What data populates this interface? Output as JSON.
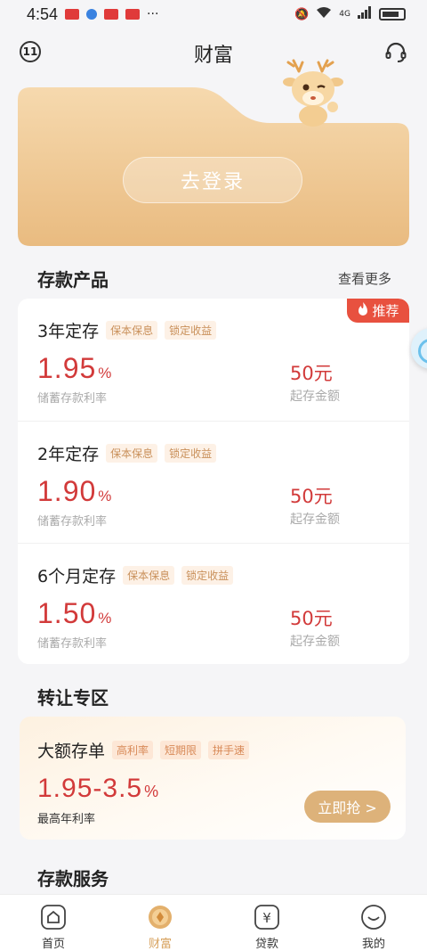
{
  "status_bar": {
    "time": "4:54",
    "network": "4G"
  },
  "header": {
    "title": "财富",
    "left_icon": "wealth-mark-icon",
    "right_icon": "headset-icon"
  },
  "hero": {
    "login_label": "去登录",
    "mascot_icon": "deer-mascot-icon"
  },
  "deposit_section": {
    "title": "存款产品",
    "more_label": "查看更多",
    "badge_label": "推荐",
    "products": [
      {
        "name": "3年定存",
        "tags": [
          "保本保息",
          "锁定收益"
        ],
        "rate": "1.95",
        "rate_unit": "%",
        "rate_label": "储蓄存款利率",
        "amount": "50元",
        "amount_label": "起存金额"
      },
      {
        "name": "2年定存",
        "tags": [
          "保本保息",
          "锁定收益"
        ],
        "rate": "1.90",
        "rate_unit": "%",
        "rate_label": "储蓄存款利率",
        "amount": "50元",
        "amount_label": "起存金额"
      },
      {
        "name": "6个月定存",
        "tags": [
          "保本保息",
          "锁定收益"
        ],
        "rate": "1.50",
        "rate_unit": "%",
        "rate_label": "储蓄存款利率",
        "amount": "50元",
        "amount_label": "起存金额"
      }
    ]
  },
  "transfer_section": {
    "title": "转让专区",
    "product": {
      "name": "大额存单",
      "tags": [
        "高利率",
        "短期限",
        "拼手速"
      ],
      "rate": "1.95-3.5",
      "rate_unit": "%",
      "rate_label": "最高年利率",
      "button_label": "立即抢 >"
    }
  },
  "service_section": {
    "title": "存款服务"
  },
  "bottom_nav": {
    "items": [
      {
        "label": "首页",
        "icon": "home-icon"
      },
      {
        "label": "财富",
        "icon": "wealth-icon"
      },
      {
        "label": "贷款",
        "icon": "loan-yen-icon"
      },
      {
        "label": "我的",
        "icon": "profile-icon"
      }
    ]
  },
  "colors": {
    "accent_gold": "#ddb27a",
    "rate_red": "#d23a3a",
    "badge_red": "#e8513f"
  }
}
